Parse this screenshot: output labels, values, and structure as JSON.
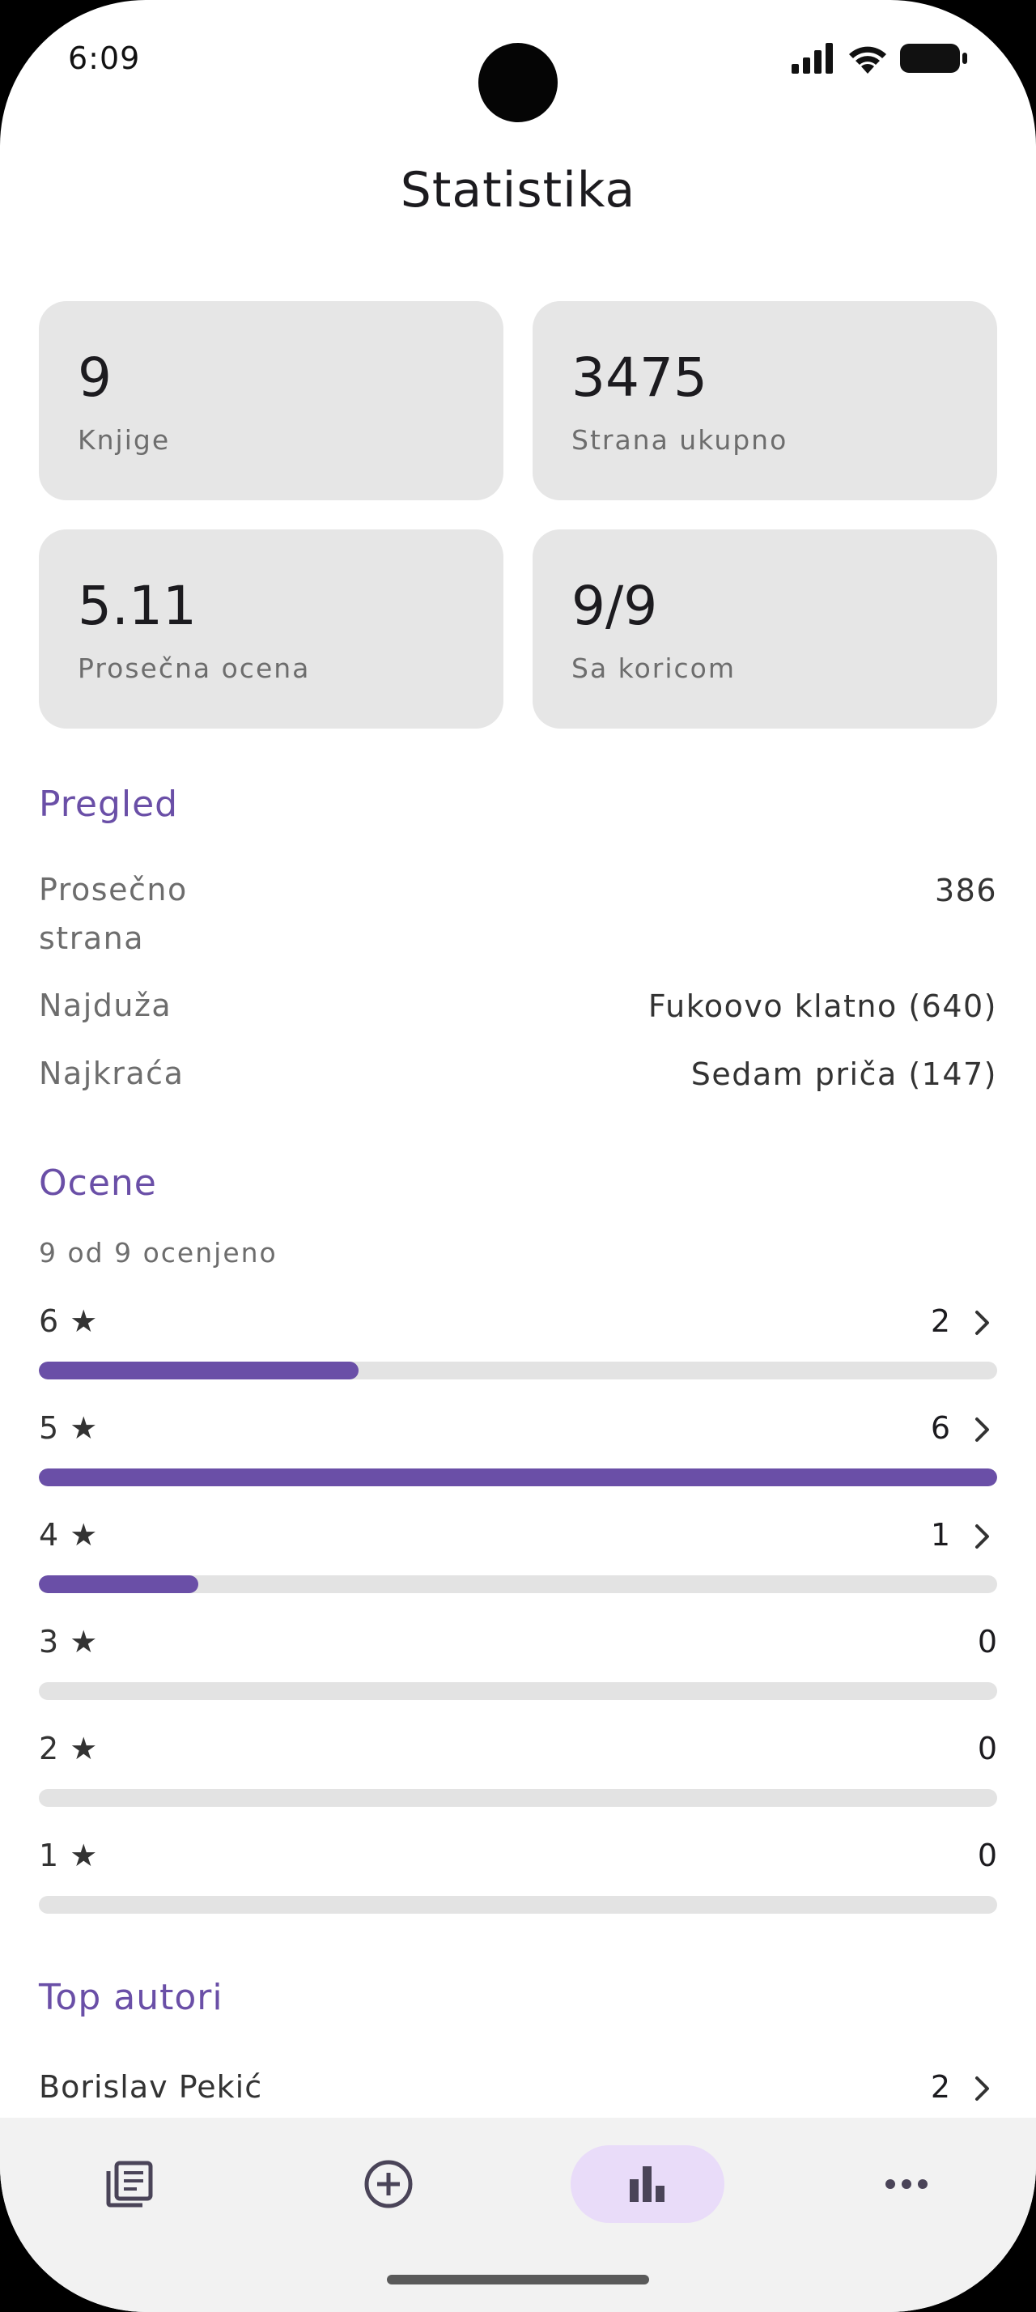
{
  "status": {
    "time": "6:09"
  },
  "title": "Statistika",
  "cards": [
    {
      "value": "9",
      "label": "Knjige"
    },
    {
      "value": "3475",
      "label": "Strana ukupno"
    },
    {
      "value": "5.11",
      "label": "Prosečna ocena"
    },
    {
      "value": "9/9",
      "label": "Sa koricom"
    }
  ],
  "overview": {
    "title": "Pregled",
    "rows": [
      {
        "label_line1": "Prosečno",
        "label_line2": "strana",
        "value": "386"
      },
      {
        "label": "Najduža",
        "value": "Fukoovo klatno (640)"
      },
      {
        "label": "Najkraća",
        "value": "Sedam priča (147)"
      }
    ]
  },
  "ratings": {
    "title": "Ocene",
    "subtitle": "9 od 9 ocenjeno",
    "max_count": 6,
    "rows": [
      {
        "label": "6 ★",
        "count": "2",
        "value": 2,
        "has_chevron": true
      },
      {
        "label": "5 ★",
        "count": "6",
        "value": 6,
        "has_chevron": true
      },
      {
        "label": "4 ★",
        "count": "1",
        "value": 1,
        "has_chevron": true
      },
      {
        "label": "3 ★",
        "count": "0",
        "value": 0,
        "has_chevron": false
      },
      {
        "label": "2 ★",
        "count": "0",
        "value": 0,
        "has_chevron": false
      },
      {
        "label": "1 ★",
        "count": "0",
        "value": 0,
        "has_chevron": false
      }
    ]
  },
  "top_authors": {
    "title": "Top autori",
    "items": [
      {
        "name": "Borislav Pekić",
        "count": "2"
      }
    ]
  },
  "nav": {
    "items": [
      {
        "icon": "library-icon",
        "active": false
      },
      {
        "icon": "add-circle-icon",
        "active": false
      },
      {
        "icon": "bar-chart-icon",
        "active": true
      },
      {
        "icon": "more-icon",
        "active": false
      }
    ]
  },
  "colors": {
    "accent": "#6a4fa7",
    "card_bg": "#e6e6e6",
    "nav_active_bg": "#e9dcf9"
  }
}
